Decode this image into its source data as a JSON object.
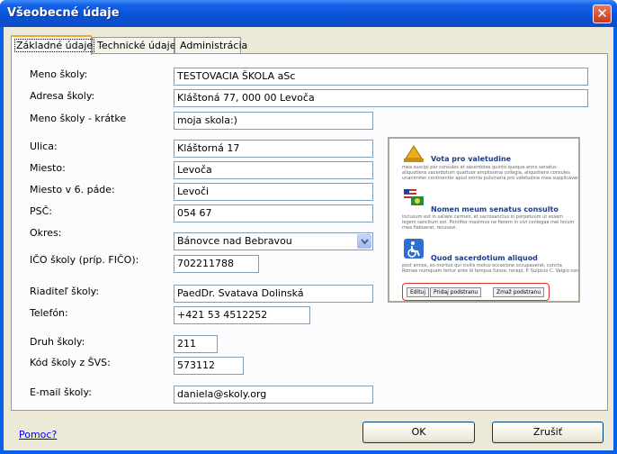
{
  "window": {
    "title": "Všeobecné údaje",
    "close_glyph": "✕"
  },
  "tabs": [
    {
      "label": "Základné údaje",
      "active": true
    },
    {
      "label": "Technické údaje",
      "active": false
    },
    {
      "label": "Administrácia",
      "active": false
    }
  ],
  "form": {
    "meno_skoly": {
      "label": "Meno školy:",
      "value": "TESTOVACIA ŠKOLA aSc"
    },
    "adresa_skoly": {
      "label": "Adresa školy:",
      "value": "Kláštoná 77, 000 00 Levoča"
    },
    "meno_kratke": {
      "label": "Meno školy - krátke",
      "value": "moja skola:)"
    },
    "ulica": {
      "label": "Ulica:",
      "value": "Kláštorná 17"
    },
    "miesto": {
      "label": "Miesto:",
      "value": "Levoča"
    },
    "miesto6": {
      "label": "Miesto v 6. páde:",
      "value": "Levoči"
    },
    "psc": {
      "label": "PSČ:",
      "value": "054 67"
    },
    "okres": {
      "label": "Okres:",
      "value": "Bánovce nad Bebravou"
    },
    "ico": {
      "label": "IČO školy (príp. FIČO):",
      "value": "702211788"
    },
    "riaditel": {
      "label": "Riaditeľ školy:",
      "value": "PaedDr. Svatava Dolinská"
    },
    "telefon": {
      "label": "Telefón:",
      "value": "+421 53 4512252"
    },
    "druh": {
      "label": "Druh školy:",
      "value": "211"
    },
    "kod_svs": {
      "label": "Kód školy z ŠVS:",
      "value": "573112"
    },
    "email": {
      "label": "E-mail školy:",
      "value": "daniela@skoly.org"
    }
  },
  "preview": {
    "items": [
      {
        "icon": "bell-icon",
        "title": "Vota pro valetudine",
        "text": [
          "mea suscipi per consules et sacerdotes quinto quoque anno senatus",
          "aliquotiens sacerdotum quattuor amplissima collegia, aliquotiens consules",
          "unanimiter continenter apud omnia pulvinaria pro valetudine mea supplicaverunt"
        ]
      },
      {
        "icon": "flags-icon",
        "title": "Nomen meum senatus consulto",
        "text": [
          "inclusum est in saliare carmen, et sacrosanctus in perpetuum ut essem",
          "legem sancitum est. Pontifex maximus ne fierem in vivi conlegae mei locum",
          "mea fiabuerat, recusavi."
        ]
      },
      {
        "icon": "wheelchair-icon",
        "title": "Quod sacerdotium aliquod",
        "text": [
          "post annos, eo mortuo qui civilis motus occasione occupaverat, cuncta",
          "Romae numquam fertur ante id tempus fuisse, recepi, P. Sulpicio C. Valgio consulibus"
        ]
      }
    ],
    "buttons": {
      "edit": "Edituj",
      "add": "Pridaj podstranu",
      "remove": "Zmaž podstranu"
    }
  },
  "footer": {
    "help": "Pomoc?",
    "ok": "OK",
    "cancel": "Zrušiť"
  },
  "colors": {
    "titlebar": "#0a52d6",
    "dialog_bg": "#ece9d8",
    "input_border": "#7f9db9",
    "tab_highlight": "#f1a533"
  }
}
